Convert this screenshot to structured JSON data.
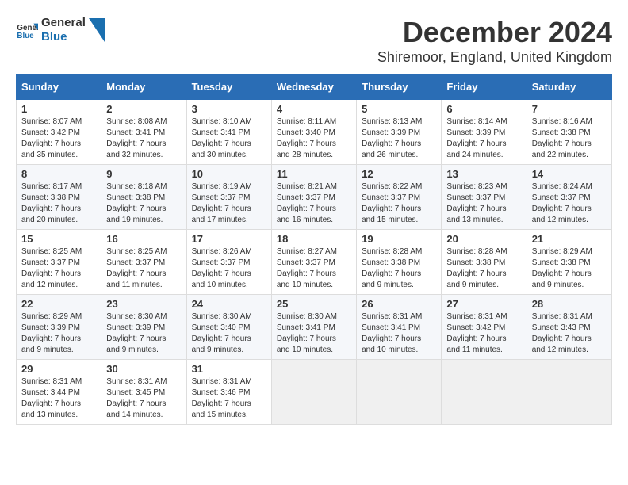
{
  "logo": {
    "text_general": "General",
    "text_blue": "Blue"
  },
  "header": {
    "month": "December 2024",
    "location": "Shiremoor, England, United Kingdom"
  },
  "days_of_week": [
    "Sunday",
    "Monday",
    "Tuesday",
    "Wednesday",
    "Thursday",
    "Friday",
    "Saturday"
  ],
  "weeks": [
    [
      {
        "day": "1",
        "sunrise": "8:07 AM",
        "sunset": "3:42 PM",
        "daylight": "7 hours and 35 minutes."
      },
      {
        "day": "2",
        "sunrise": "8:08 AM",
        "sunset": "3:41 PM",
        "daylight": "7 hours and 32 minutes."
      },
      {
        "day": "3",
        "sunrise": "8:10 AM",
        "sunset": "3:41 PM",
        "daylight": "7 hours and 30 minutes."
      },
      {
        "day": "4",
        "sunrise": "8:11 AM",
        "sunset": "3:40 PM",
        "daylight": "7 hours and 28 minutes."
      },
      {
        "day": "5",
        "sunrise": "8:13 AM",
        "sunset": "3:39 PM",
        "daylight": "7 hours and 26 minutes."
      },
      {
        "day": "6",
        "sunrise": "8:14 AM",
        "sunset": "3:39 PM",
        "daylight": "7 hours and 24 minutes."
      },
      {
        "day": "7",
        "sunrise": "8:16 AM",
        "sunset": "3:38 PM",
        "daylight": "7 hours and 22 minutes."
      }
    ],
    [
      {
        "day": "8",
        "sunrise": "8:17 AM",
        "sunset": "3:38 PM",
        "daylight": "7 hours and 20 minutes."
      },
      {
        "day": "9",
        "sunrise": "8:18 AM",
        "sunset": "3:38 PM",
        "daylight": "7 hours and 19 minutes."
      },
      {
        "day": "10",
        "sunrise": "8:19 AM",
        "sunset": "3:37 PM",
        "daylight": "7 hours and 17 minutes."
      },
      {
        "day": "11",
        "sunrise": "8:21 AM",
        "sunset": "3:37 PM",
        "daylight": "7 hours and 16 minutes."
      },
      {
        "day": "12",
        "sunrise": "8:22 AM",
        "sunset": "3:37 PM",
        "daylight": "7 hours and 15 minutes."
      },
      {
        "day": "13",
        "sunrise": "8:23 AM",
        "sunset": "3:37 PM",
        "daylight": "7 hours and 13 minutes."
      },
      {
        "day": "14",
        "sunrise": "8:24 AM",
        "sunset": "3:37 PM",
        "daylight": "7 hours and 12 minutes."
      }
    ],
    [
      {
        "day": "15",
        "sunrise": "8:25 AM",
        "sunset": "3:37 PM",
        "daylight": "7 hours and 12 minutes."
      },
      {
        "day": "16",
        "sunrise": "8:25 AM",
        "sunset": "3:37 PM",
        "daylight": "7 hours and 11 minutes."
      },
      {
        "day": "17",
        "sunrise": "8:26 AM",
        "sunset": "3:37 PM",
        "daylight": "7 hours and 10 minutes."
      },
      {
        "day": "18",
        "sunrise": "8:27 AM",
        "sunset": "3:37 PM",
        "daylight": "7 hours and 10 minutes."
      },
      {
        "day": "19",
        "sunrise": "8:28 AM",
        "sunset": "3:38 PM",
        "daylight": "7 hours and 9 minutes."
      },
      {
        "day": "20",
        "sunrise": "8:28 AM",
        "sunset": "3:38 PM",
        "daylight": "7 hours and 9 minutes."
      },
      {
        "day": "21",
        "sunrise": "8:29 AM",
        "sunset": "3:38 PM",
        "daylight": "7 hours and 9 minutes."
      }
    ],
    [
      {
        "day": "22",
        "sunrise": "8:29 AM",
        "sunset": "3:39 PM",
        "daylight": "7 hours and 9 minutes."
      },
      {
        "day": "23",
        "sunrise": "8:30 AM",
        "sunset": "3:39 PM",
        "daylight": "7 hours and 9 minutes."
      },
      {
        "day": "24",
        "sunrise": "8:30 AM",
        "sunset": "3:40 PM",
        "daylight": "7 hours and 9 minutes."
      },
      {
        "day": "25",
        "sunrise": "8:30 AM",
        "sunset": "3:41 PM",
        "daylight": "7 hours and 10 minutes."
      },
      {
        "day": "26",
        "sunrise": "8:31 AM",
        "sunset": "3:41 PM",
        "daylight": "7 hours and 10 minutes."
      },
      {
        "day": "27",
        "sunrise": "8:31 AM",
        "sunset": "3:42 PM",
        "daylight": "7 hours and 11 minutes."
      },
      {
        "day": "28",
        "sunrise": "8:31 AM",
        "sunset": "3:43 PM",
        "daylight": "7 hours and 12 minutes."
      }
    ],
    [
      {
        "day": "29",
        "sunrise": "8:31 AM",
        "sunset": "3:44 PM",
        "daylight": "7 hours and 13 minutes."
      },
      {
        "day": "30",
        "sunrise": "8:31 AM",
        "sunset": "3:45 PM",
        "daylight": "7 hours and 14 minutes."
      },
      {
        "day": "31",
        "sunrise": "8:31 AM",
        "sunset": "3:46 PM",
        "daylight": "7 hours and 15 minutes."
      },
      null,
      null,
      null,
      null
    ]
  ],
  "labels": {
    "sunrise": "Sunrise:",
    "sunset": "Sunset:",
    "daylight": "Daylight:"
  }
}
